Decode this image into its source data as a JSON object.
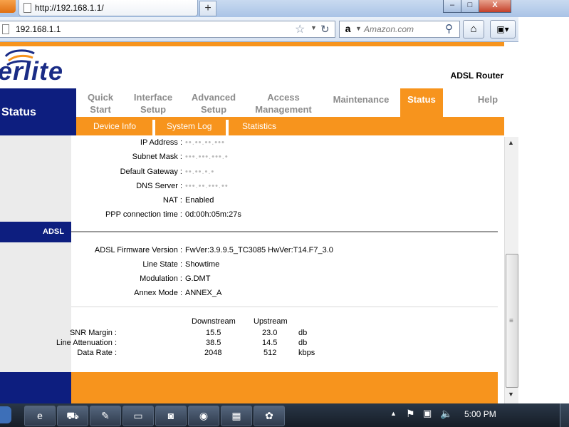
{
  "browser": {
    "tab_title": "http://192.168.1.1/",
    "new_tab_label": "+",
    "url": "192.168.1.1",
    "search_placeholder": "Amazon.com",
    "window_controls": {
      "minimize": "–",
      "maximize": "□",
      "close": "X"
    }
  },
  "router": {
    "logo_text": "erlite",
    "product_name": "ADSL Router",
    "section_title": "Status",
    "main_nav": [
      {
        "label": "Quick Start",
        "active": false
      },
      {
        "label": "Interface Setup",
        "active": false
      },
      {
        "label": "Advanced Setup",
        "active": false
      },
      {
        "label": "Access Management",
        "active": false
      },
      {
        "label": "Maintenance",
        "active": false
      },
      {
        "label": "Status",
        "active": true
      },
      {
        "label": "Help",
        "active": false
      }
    ],
    "sub_nav": [
      "Device Info",
      "System Log",
      "Statistics"
    ],
    "wan": [
      {
        "label": "IP Address :",
        "value": "••.••.••.•••",
        "obscured": true
      },
      {
        "label": "Subnet Mask :",
        "value": "•••.•••.•••.•",
        "obscured": true
      },
      {
        "label": "Default Gateway :",
        "value": "••.••.•.•",
        "obscured": true
      },
      {
        "label": "DNS Server :",
        "value": "•••.••.•••.••",
        "obscured": true
      },
      {
        "label": "NAT :",
        "value": "Enabled",
        "obscured": false
      },
      {
        "label": "PPP connection time :",
        "value": "0d:00h:05m:27s",
        "obscured": false
      }
    ],
    "adsl_section_label": "ADSL",
    "adsl": [
      {
        "label": "ADSL Firmware Version :",
        "value": "FwVer:3.9.9.5_TC3085 HwVer:T14.F7_3.0"
      },
      {
        "label": "Line State :",
        "value": "Showtime"
      },
      {
        "label": "Modulation :",
        "value": "G.DMT"
      },
      {
        "label": "Annex Mode :",
        "value": "ANNEX_A"
      }
    ],
    "stats": {
      "headers": [
        "Downstream",
        "Upstream"
      ],
      "rows": [
        {
          "label": "SNR Margin :",
          "down": "15.5",
          "up": "23.0",
          "unit": "db"
        },
        {
          "label": "Line Attenuation :",
          "down": "38.5",
          "up": "14.5",
          "unit": "db"
        },
        {
          "label": "Data Rate :",
          "down": "2048",
          "up": "512",
          "unit": "kbps"
        }
      ]
    }
  },
  "taskbar": {
    "clock": "5:00 PM",
    "apps": [
      "ie-icon",
      "network-icon",
      "eraser-icon",
      "window-icon",
      "green-app-icon",
      "firefox-icon",
      "app-grid-icon",
      "paint-icon"
    ]
  },
  "colors": {
    "orange": "#f7941d",
    "navy": "#0d1e7f",
    "leftcol": "#ebebeb"
  }
}
